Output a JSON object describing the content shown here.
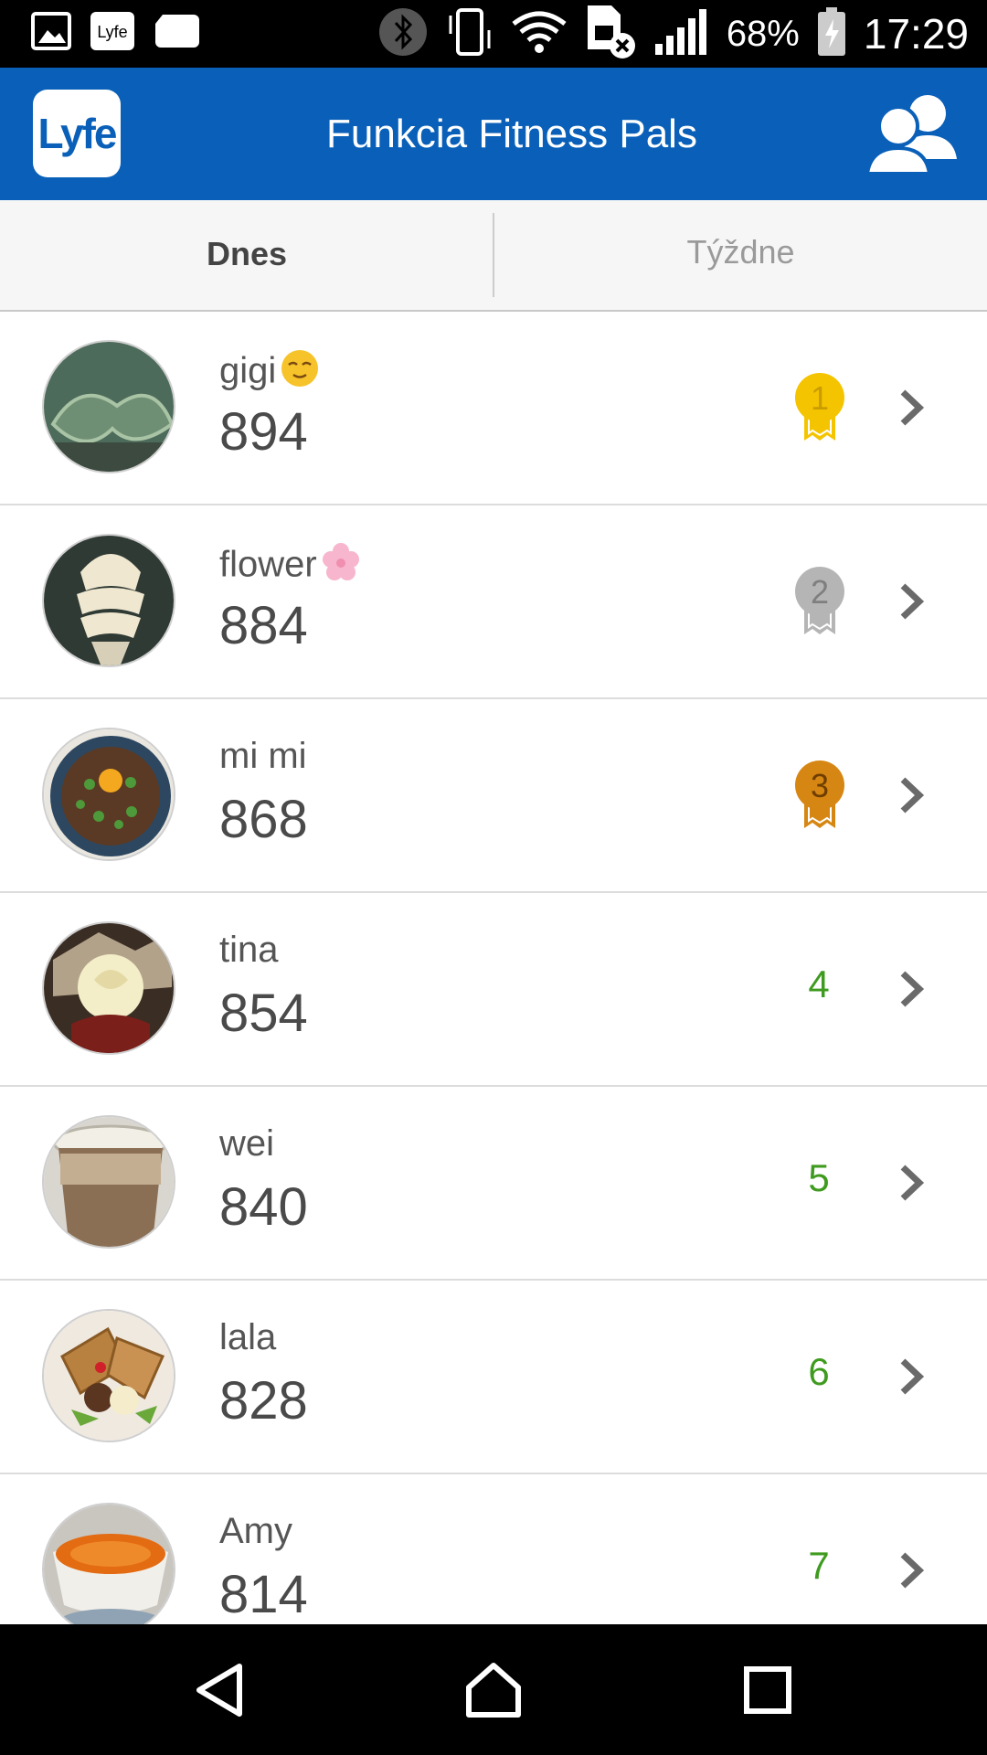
{
  "status_bar": {
    "battery": "68%",
    "time": "17:29"
  },
  "header": {
    "logo": "Lyfe",
    "title": "Funkcia Fitness Pals"
  },
  "tabs": {
    "today": "Dnes",
    "week": "Týždne"
  },
  "leaderboard": [
    {
      "name": "gigi",
      "score": "894",
      "rank": "1",
      "medal": "gold"
    },
    {
      "name": "flower",
      "score": "884",
      "rank": "2",
      "medal": "silver"
    },
    {
      "name": "mi mi",
      "score": "868",
      "rank": "3",
      "medal": "bronze"
    },
    {
      "name": "tina",
      "score": "854",
      "rank": "4"
    },
    {
      "name": "wei",
      "score": "840",
      "rank": "5"
    },
    {
      "name": "lala",
      "score": "828",
      "rank": "6"
    },
    {
      "name": "Amy",
      "score": "814",
      "rank": "7"
    }
  ],
  "colors": {
    "app_bar": "#0a60b8",
    "rank_text": "#3f9b1f",
    "gold": "#f5c400",
    "silver": "#b5b5b5",
    "bronze": "#d68612"
  }
}
